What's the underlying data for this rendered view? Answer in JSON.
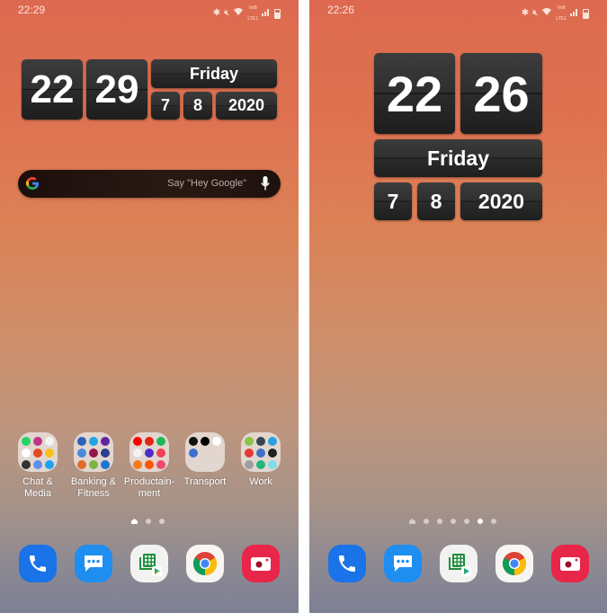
{
  "screens": [
    {
      "id": "left",
      "status_bar": {
        "time": "22:29",
        "network_top": "VoB",
        "network_bottom": "LTE1",
        "signal_label": "R"
      },
      "clock": {
        "hour": "22",
        "minute": "29",
        "day_name": "Friday",
        "day": "7",
        "month": "8",
        "year": "2020"
      },
      "search": {
        "placeholder": "Say \"Hey Google\""
      },
      "folders": [
        {
          "label": "Chat &\nMedia",
          "apps": [
            "whatsapp",
            "instagram",
            "photos-pinwheel",
            "google-photos",
            "office",
            "keep",
            "music-player",
            "messages",
            "twitter"
          ]
        },
        {
          "label": "Banking &\nFitness",
          "apps": [
            "bank",
            "paytm",
            "phonepe",
            "google-pay",
            "axis-bank",
            "gym",
            "fitness",
            "fit-app",
            "health"
          ]
        },
        {
          "label": "Productain-\nment",
          "apps": [
            "youtube",
            "youtube-music",
            "spotify",
            "podcasts",
            "tv",
            "pocket",
            "audible",
            "soundcloud",
            "app"
          ]
        },
        {
          "label": "Transport",
          "apps": [
            "ola",
            "uber",
            "maps",
            "trains"
          ]
        },
        {
          "label": "Work",
          "apps": [
            "keep-notes",
            "linkedin",
            "docs",
            "kite",
            "files",
            "recorder",
            "phone-link",
            "meet",
            "browser"
          ]
        }
      ],
      "page_indicator": {
        "count": 3,
        "active_index": 0,
        "home_index": 0
      },
      "dock": [
        {
          "name": "Phone",
          "icon": "phone-icon"
        },
        {
          "name": "Messages",
          "icon": "message-icon"
        },
        {
          "name": "Sheets Play",
          "icon": "sheets-play-icon"
        },
        {
          "name": "Chrome",
          "icon": "chrome-icon"
        },
        {
          "name": "Camera",
          "icon": "camera-icon"
        }
      ]
    },
    {
      "id": "right",
      "status_bar": {
        "time": "22:26",
        "network_top": "VoB",
        "network_bottom": "LTE1",
        "signal_label": "R"
      },
      "clock": {
        "hour": "22",
        "minute": "26",
        "day_name": "Friday",
        "day": "7",
        "month": "8",
        "year": "2020"
      },
      "page_indicator": {
        "count": 7,
        "active_index": 5,
        "home_index": 0
      },
      "dock": [
        {
          "name": "Phone",
          "icon": "phone-icon"
        },
        {
          "name": "Messages",
          "icon": "message-icon"
        },
        {
          "name": "Sheets Play",
          "icon": "sheets-play-icon"
        },
        {
          "name": "Chrome",
          "icon": "chrome-icon"
        },
        {
          "name": "Camera",
          "icon": "camera-icon"
        }
      ]
    }
  ],
  "colors": {
    "wallpaper_top": "#dd6a50",
    "wallpaper_bottom": "#7d7f94",
    "clock_tile": "#2f2f2f",
    "phone": "#1a73e8",
    "messages": "#1e8ef0",
    "camera": "#e8264a"
  }
}
